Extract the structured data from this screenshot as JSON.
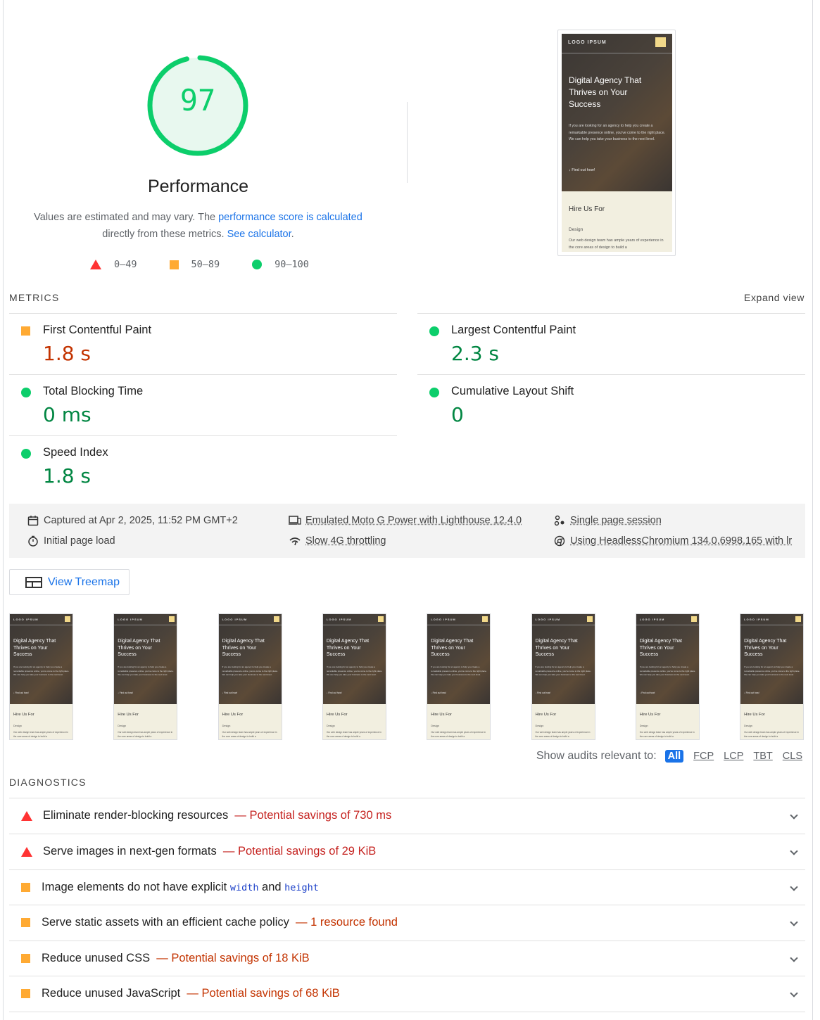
{
  "gauge": {
    "score": "97",
    "title": "Performance",
    "color": "#0cce6b",
    "fraction": 0.97
  },
  "description": {
    "part1": "Values are estimated and may vary. The ",
    "link1": "performance score is calculated",
    "part2": "directly from these metrics. ",
    "link2": "See calculator",
    "part3": "."
  },
  "legend": [
    {
      "shape": "triangle-red",
      "range": "0–49"
    },
    {
      "shape": "square-orange",
      "range": "50–89"
    },
    {
      "shape": "circle-green",
      "range": "90–100"
    }
  ],
  "screenshot": {
    "logo": "LOGO IPSUM",
    "hero_title": "Digital Agency That Thrives on Your Success",
    "hero_body": "If you are looking for an agency to help you create a remarkable presence online, you've come to the right place. We can help you take your business to the next level.",
    "cta": "↓   Find out how!",
    "hire": "Hire Us For",
    "design": "Design",
    "design_text": "Our web design team has ample years of experience in the core areas of design to build a"
  },
  "metrics": {
    "label": "METRICS",
    "expand": "Expand view",
    "items": [
      {
        "name": "First Contentful Paint",
        "value": "1.8 s",
        "status": "orange"
      },
      {
        "name": "Largest Contentful Paint",
        "value": "2.3 s",
        "status": "green"
      },
      {
        "name": "Total Blocking Time",
        "value": "0 ms",
        "status": "green"
      },
      {
        "name": "Cumulative Layout Shift",
        "value": "0",
        "status": "green"
      },
      {
        "name": "Speed Index",
        "value": "1.8 s",
        "status": "green"
      }
    ]
  },
  "info": {
    "captured": "Captured at Apr 2, 2025, 11:52 PM GMT+2",
    "load": "Initial page load",
    "device": "Emulated Moto G Power with Lighthouse 12.4.0",
    "throttle": "Slow 4G throttling",
    "session": "Single page session",
    "browser": "Using HeadlessChromium 134.0.6998.165 with lr"
  },
  "treemap": {
    "label": "View Treemap"
  },
  "filter": {
    "label": "Show audits relevant to:",
    "chips": [
      "All",
      "FCP",
      "LCP",
      "TBT",
      "CLS"
    ]
  },
  "diagnostics": {
    "label": "DIAGNOSTICS",
    "items": [
      {
        "icon": "triangle-red",
        "title": "Eliminate render-blocking resources",
        "savings": "— Potential savings of 730 ms"
      },
      {
        "icon": "triangle-red",
        "title": "Serve images in next-gen formats",
        "savings": "— Potential savings of 29 KiB"
      },
      {
        "icon": "square-orange",
        "title_a": "Image elements do not have explicit ",
        "code1": "width",
        "title_b": " and ",
        "code2": "height"
      },
      {
        "icon": "square-orange",
        "title": "Serve static assets with an efficient cache policy",
        "savings": "— 1 resource found"
      },
      {
        "icon": "square-orange",
        "title": "Reduce unused CSS",
        "savings": "— Potential savings of 18 KiB"
      },
      {
        "icon": "square-orange",
        "title": "Reduce unused JavaScript",
        "savings": "— Potential savings of 68 KiB"
      }
    ]
  }
}
